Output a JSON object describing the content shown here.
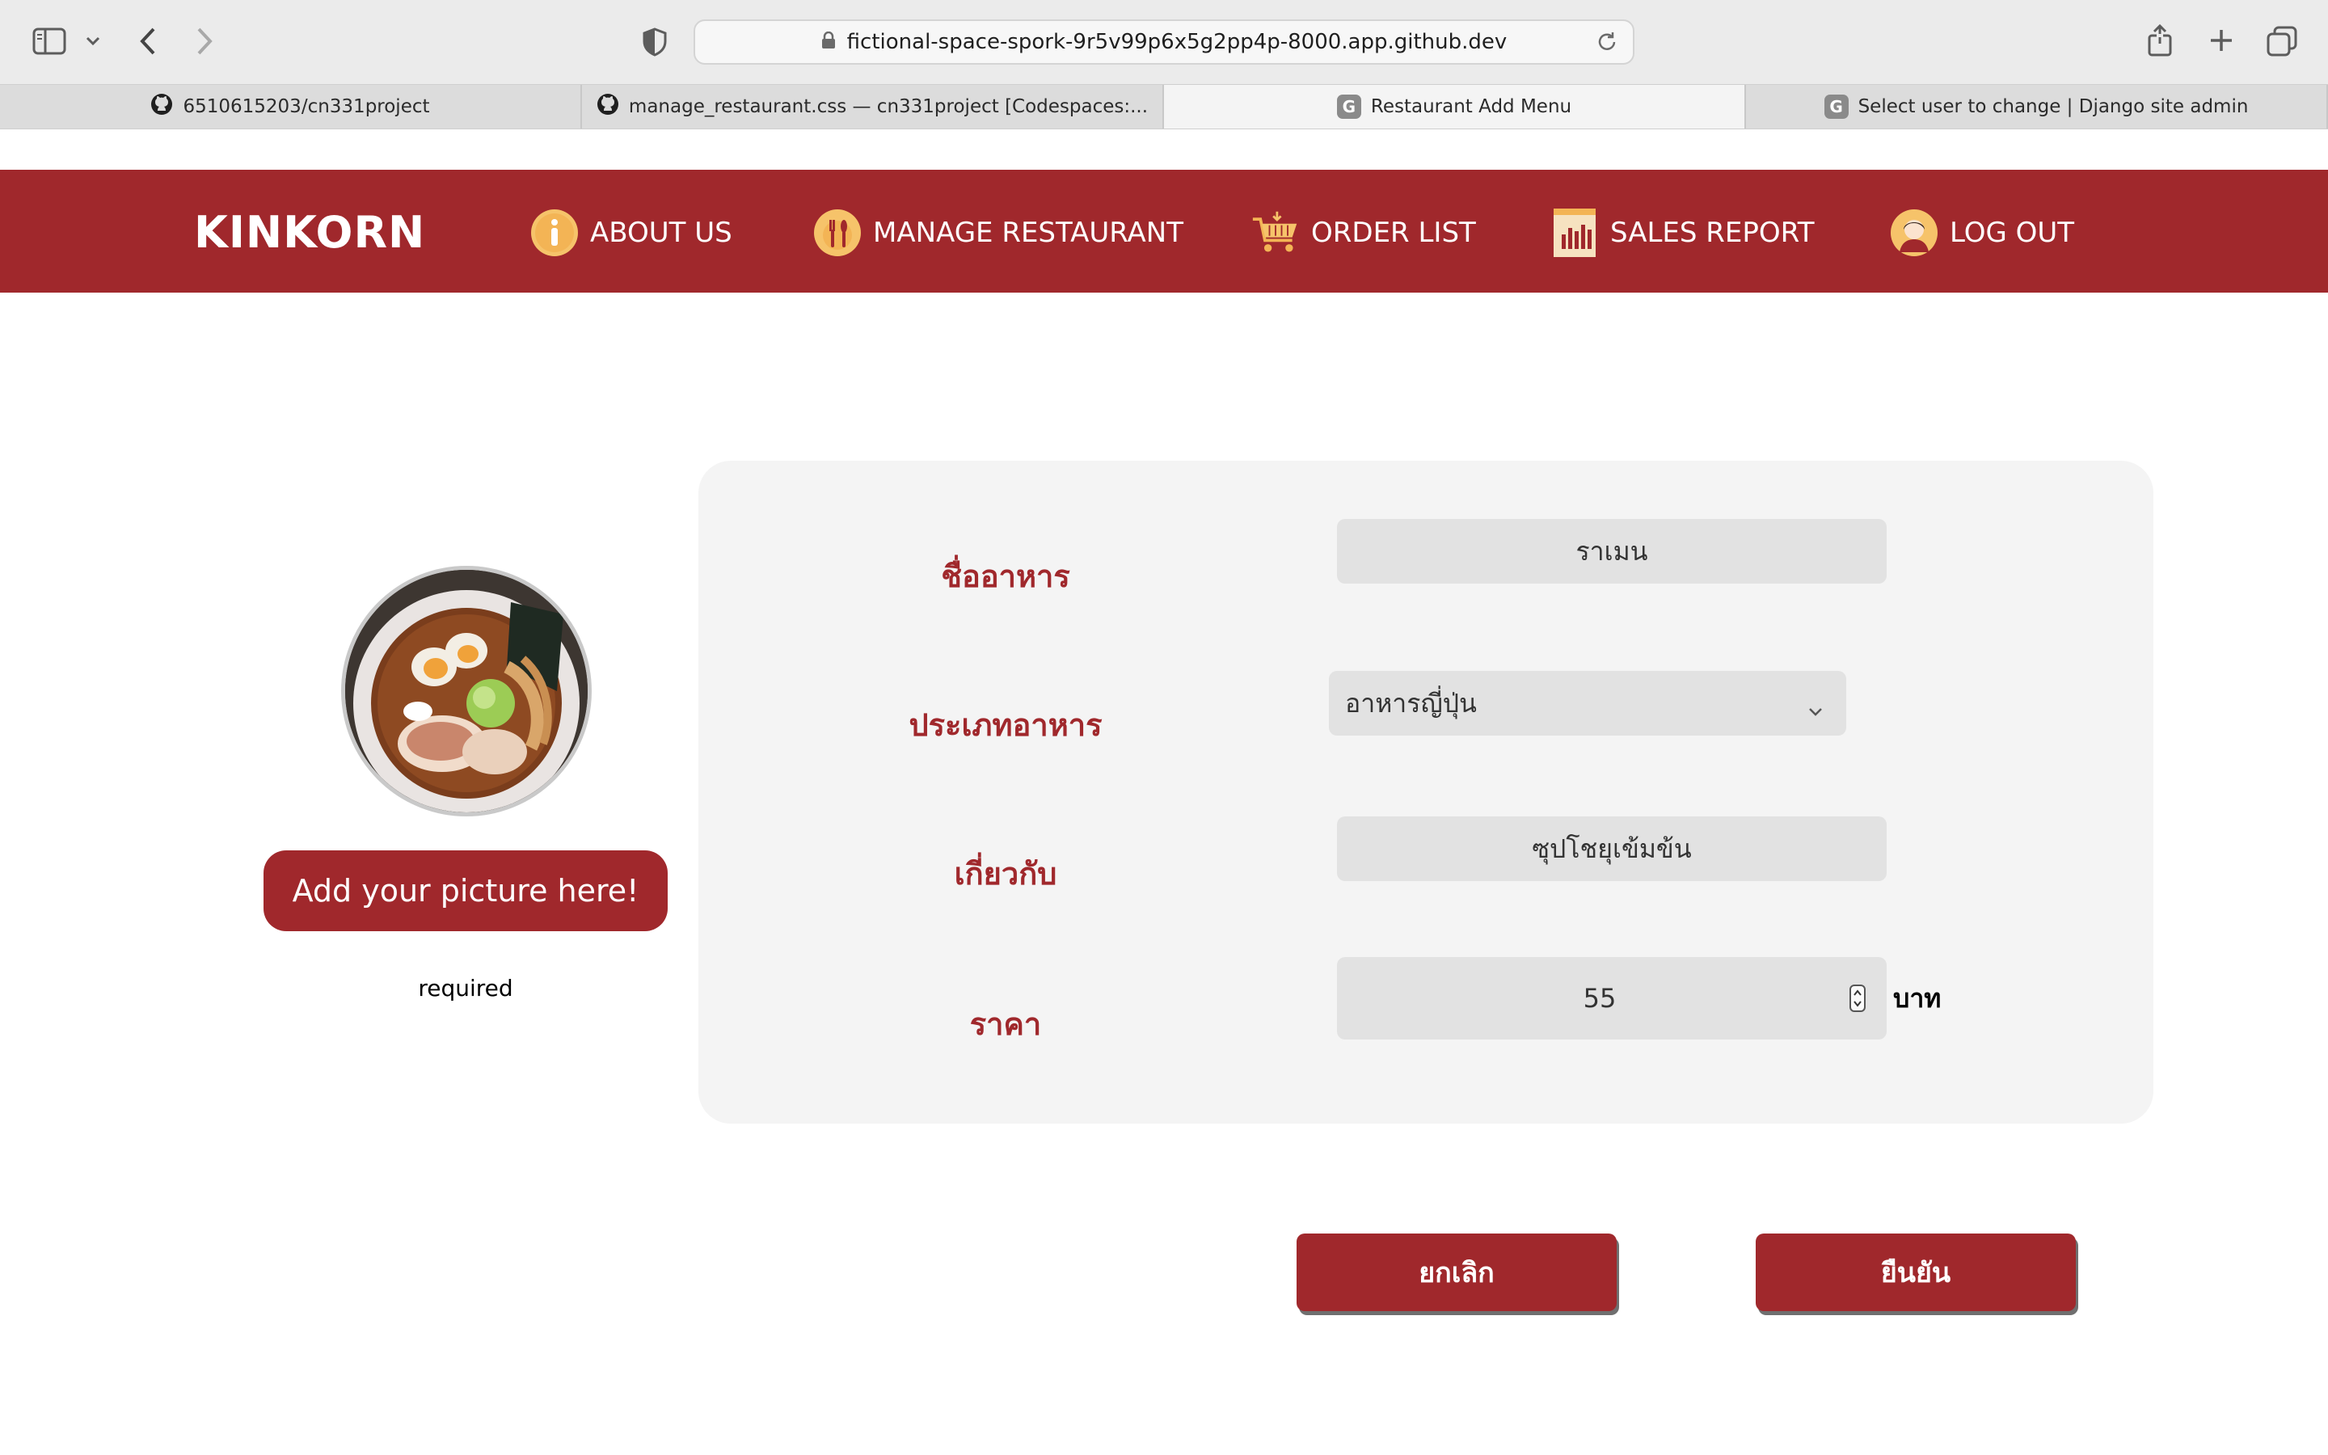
{
  "browser": {
    "url": "fictional-space-spork-9r5v99p6x5g2pp4p-8000.app.github.dev",
    "tabs": [
      {
        "title": "6510615203/cn331project",
        "favicon": "github-icon"
      },
      {
        "title": "manage_restaurant.css — cn331project [Codespaces:...",
        "favicon": "github-icon"
      },
      {
        "title": "Restaurant Add Menu",
        "favicon": "G",
        "active": true
      },
      {
        "title": "Select user to change | Django site admin",
        "favicon": "G"
      }
    ]
  },
  "nav": {
    "brand": "KINKORN",
    "items": [
      {
        "label": "ABOUT US",
        "icon": "info-icon"
      },
      {
        "label": "MANAGE RESTAURANT",
        "icon": "dining-icon"
      },
      {
        "label": "ORDER LIST",
        "icon": "cart-icon"
      },
      {
        "label": "SALES REPORT",
        "icon": "report-icon"
      },
      {
        "label": "LOG OUT",
        "icon": "user-avatar-icon"
      }
    ]
  },
  "picture": {
    "button_label": "Add your picture here!",
    "required_text": "required"
  },
  "form": {
    "name_label": "ชื่ออาหาร",
    "name_value": "ราเมน",
    "type_label": "ประเภทอาหาร",
    "type_value": "อาหารญี่ปุ่น",
    "about_label": "เกี่ยวกับ",
    "about_value": "ซุปโชยุเข้มข้น",
    "price_label": "ราคา",
    "price_value": "55",
    "price_unit": "บาท"
  },
  "actions": {
    "cancel_label": "ยกเลิก",
    "confirm_label": "ยืนยัน"
  },
  "colors": {
    "brand": "#a0282c",
    "panel": "#f4f4f4",
    "input": "#e2e2e2"
  }
}
